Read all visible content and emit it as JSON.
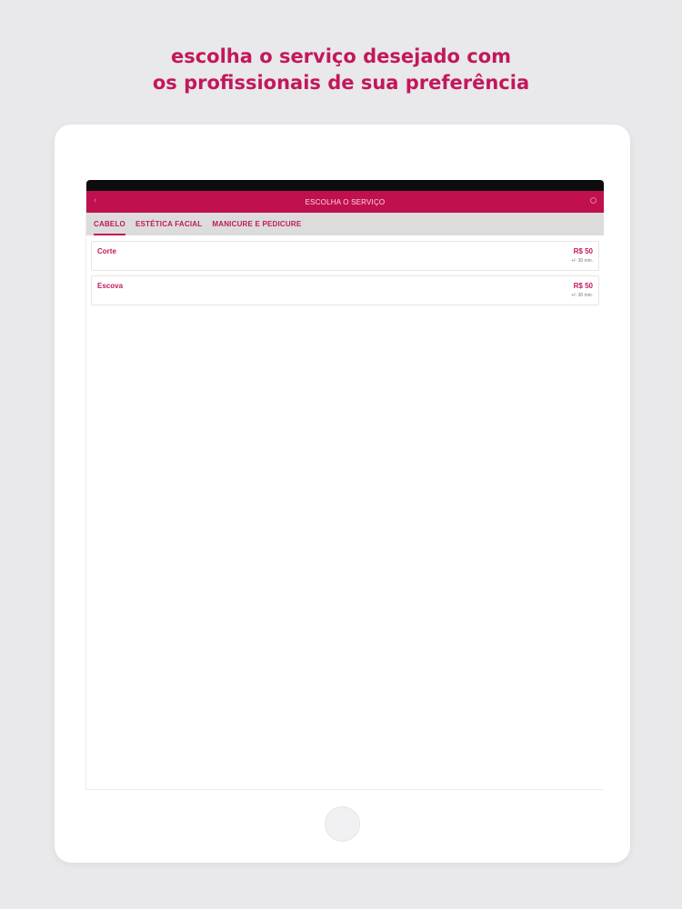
{
  "headline": {
    "line1": "escolha o serviço desejado com",
    "line2": "os profissionais de sua preferência"
  },
  "app": {
    "title": "ESCOLHA O SERVIÇO",
    "back_glyph": "‹",
    "search_icon": "search-icon",
    "accent_color": "#c2185b"
  },
  "tabs": [
    {
      "label": "CABELO",
      "active": true
    },
    {
      "label": "ESTÉTICA FACIAL",
      "active": false
    },
    {
      "label": "MANICURE E PEDICURE",
      "active": false
    }
  ],
  "services": [
    {
      "name": "Corte",
      "price": "R$ 50",
      "duration": "+/- 30 min."
    },
    {
      "name": "Escova",
      "price": "R$ 50",
      "duration": "+/- 30 min."
    }
  ]
}
